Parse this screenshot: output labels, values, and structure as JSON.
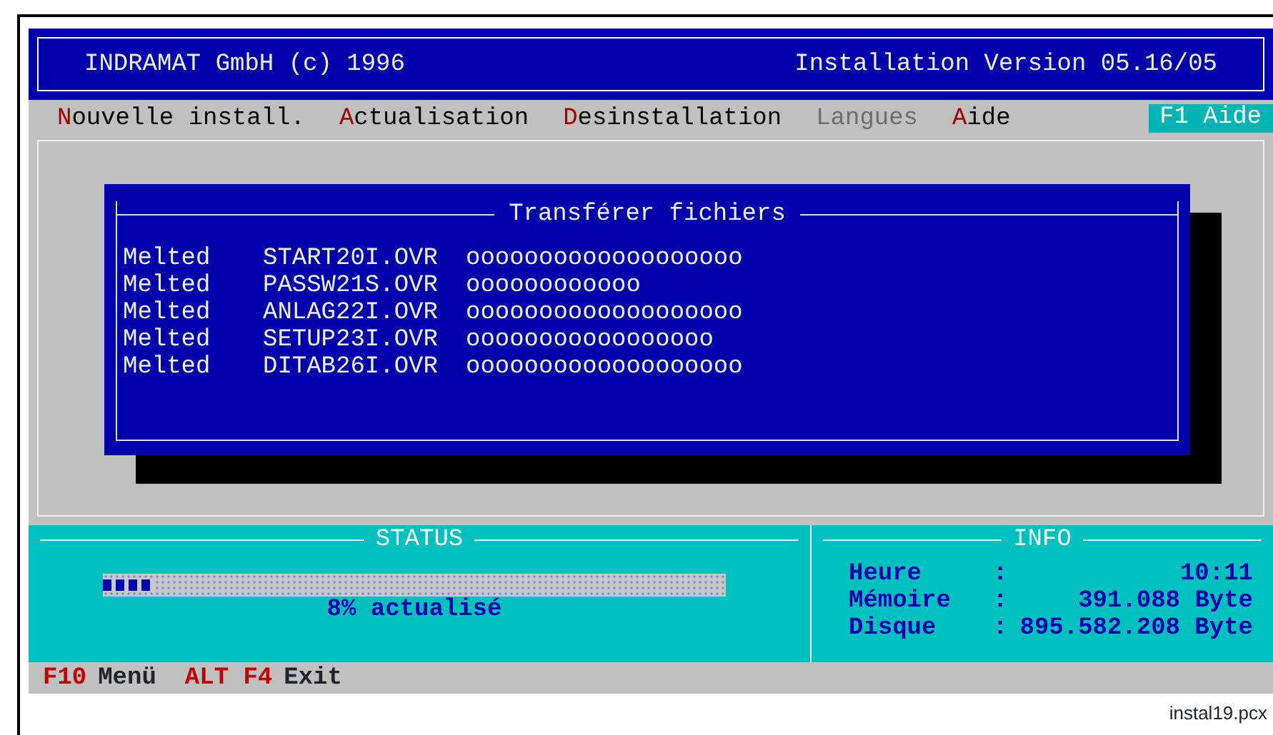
{
  "header": {
    "left": "INDRAMAT GmbH (c) 1996",
    "right": "Installation Version 05.16/05"
  },
  "menu": [
    {
      "label": "Nouvelle install.",
      "disabled": false
    },
    {
      "label": "Actualisation",
      "disabled": false
    },
    {
      "label": "Desinstallation",
      "disabled": false
    },
    {
      "label": "Langues",
      "disabled": true
    },
    {
      "label": "Aide",
      "disabled": false
    }
  ],
  "help_key": "F1 Aide",
  "dialog": {
    "title": "Transférer fichiers",
    "rows": [
      {
        "status": "Melted",
        "file": "START20I.OVR",
        "progress": "ooooooooooooooooooo"
      },
      {
        "status": "Melted",
        "file": "PASSW21S.OVR",
        "progress": "oooooooooooo"
      },
      {
        "status": "Melted",
        "file": "ANLAG22I.OVR",
        "progress": "ooooooooooooooooooo"
      },
      {
        "status": "Melted",
        "file": "SETUP23I.OVR",
        "progress": "ooooooooooooooooo"
      },
      {
        "status": "Melted",
        "file": "DITAB26I.OVR",
        "progress": "ooooooooooooooooooo"
      }
    ]
  },
  "status": {
    "title": "STATUS",
    "level": 0.08,
    "reading": "8% actualisé"
  },
  "info": {
    "title": "INFO",
    "rows": [
      {
        "label": "Heure",
        "sep": ":",
        "value": "10:11"
      },
      {
        "label": "Mémoire",
        "sep": ":",
        "value": "391.088 Byte"
      },
      {
        "label": "Disque",
        "sep": ":",
        "value": "895.582.208 Byte"
      }
    ]
  },
  "footer": [
    {
      "key": "F10",
      "label": "Menü"
    },
    {
      "key": "ALT F4",
      "label": "Exit"
    }
  ],
  "caption": "instal19.pcx"
}
